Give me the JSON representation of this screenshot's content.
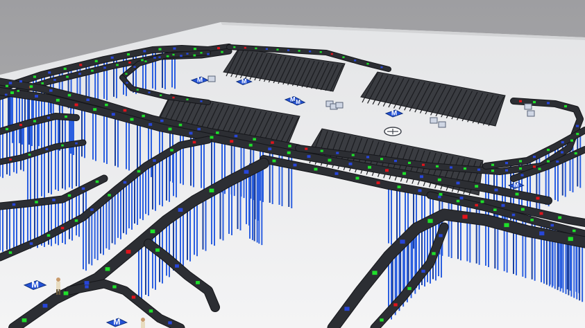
{
  "scene": {
    "colors": {
      "background_sky": "#a9a9ab",
      "floor": "#eeeff0",
      "conveyor_belt": "#2c2e33",
      "support_legs": "#2b5fe0",
      "tray_green": "#1ee02a",
      "tray_blue": "#2746d9",
      "tray_red": "#e0141c"
    },
    "sign_glyph": "M",
    "icons": [
      "station-sign-icon",
      "operator-figure-icon",
      "turntable-icon"
    ]
  }
}
